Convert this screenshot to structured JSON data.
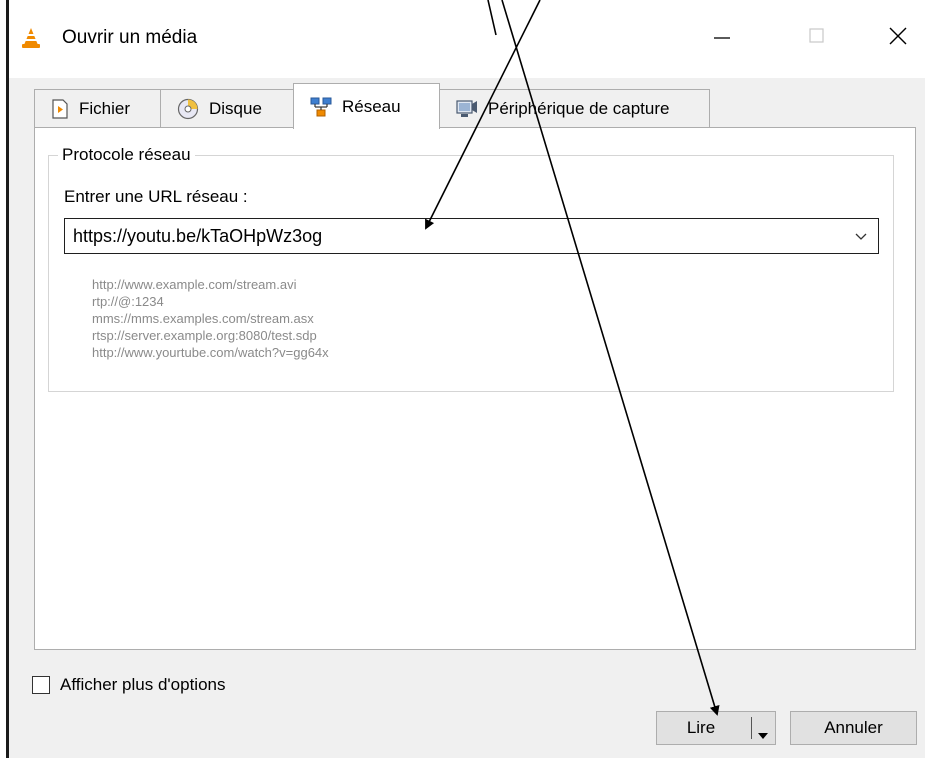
{
  "window": {
    "title": "Ouvrir un média",
    "app_icon": "vlc-cone-icon",
    "minimize_icon": "minimize-icon",
    "maximize_icon": "maximize-icon",
    "close_icon": "close-icon"
  },
  "tabs": [
    {
      "label": "Fichier",
      "icon": "file-play-icon",
      "active": false
    },
    {
      "label": "Disque",
      "icon": "disc-icon",
      "active": false
    },
    {
      "label": "Réseau",
      "icon": "network-icon",
      "active": true
    },
    {
      "label": "Périphérique de capture",
      "icon": "capture-device-icon",
      "active": false
    }
  ],
  "network": {
    "group_title": "Protocole réseau",
    "url_label": "Entrer une URL réseau :",
    "url_value": "https://youtu.be/kTaOHpWz3og",
    "examples": [
      "http://www.example.com/stream.avi",
      "rtp://@:1234",
      "mms://mms.examples.com/stream.asx",
      "rtsp://server.example.org:8080/test.sdp",
      "http://www.yourtube.com/watch?v=gg64x"
    ]
  },
  "options": {
    "show_more_label": "Afficher plus d'options",
    "checked": false
  },
  "buttons": {
    "play_label": "Lire",
    "cancel_label": "Annuler"
  },
  "colors": {
    "vlc_orange": "#f08a00",
    "tab_border": "#adadad",
    "example_text": "#8a8a8a",
    "button_bg": "#e1e1e1"
  }
}
